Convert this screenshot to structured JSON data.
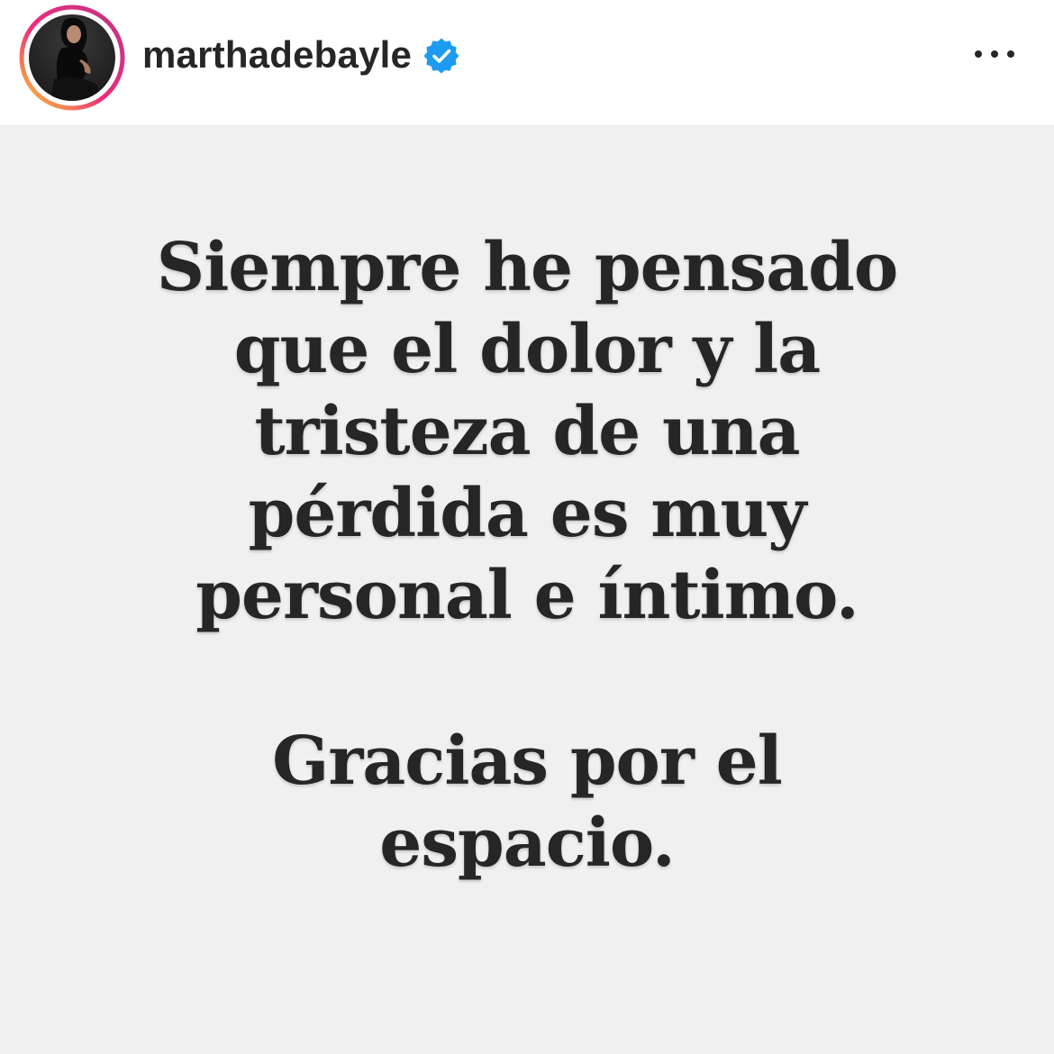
{
  "header": {
    "username": "marthadebayle",
    "verified_icon": "verified-badge-icon",
    "more_icon": "more-options-icon",
    "accent_colors": {
      "verified": "#1d9bf0",
      "story_ring_start": "#f9ce34",
      "story_ring_mid": "#ee2a7b",
      "story_ring_end": "#6228d7"
    }
  },
  "post": {
    "background": "#f0f0f0",
    "message_lines": [
      "Siempre he pensado",
      "que el dolor y la",
      "tristeza de una",
      "pérdida es muy",
      "personal e íntimo."
    ],
    "closing_lines": [
      "Gracias por el",
      "espacio."
    ]
  }
}
